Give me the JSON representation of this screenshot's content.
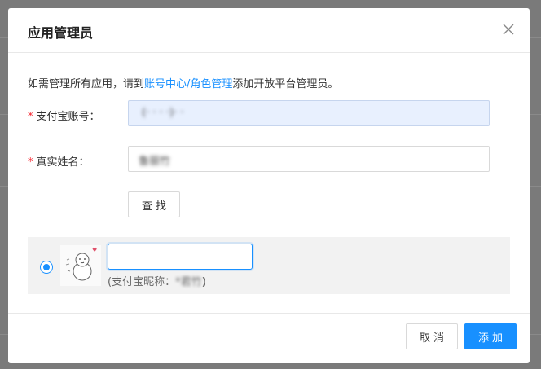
{
  "dialog": {
    "title": "应用管理员",
    "notice_prefix": "如需管理所有应用，请到",
    "notice_link": "账号中心/角色管理",
    "notice_suffix": "添加开放平台管理员。"
  },
  "form": {
    "alipay_account": {
      "required_mark": "*",
      "label": "支付宝账号：",
      "value": "(· · · ·)· ·"
    },
    "real_name": {
      "required_mark": "*",
      "label": "真实姓名：",
      "value": "鲁丽竹"
    },
    "search_label": "查找"
  },
  "result": {
    "selected": true,
    "nickname_input_value": "",
    "nickname_prefix": "(支付宝昵称：",
    "nickname_value": "*君竹",
    "nickname_suffix": ")"
  },
  "footer": {
    "cancel_label": "取消",
    "add_label": "添加"
  },
  "colors": {
    "accent": "#1890ff",
    "required": "#f5222d"
  }
}
